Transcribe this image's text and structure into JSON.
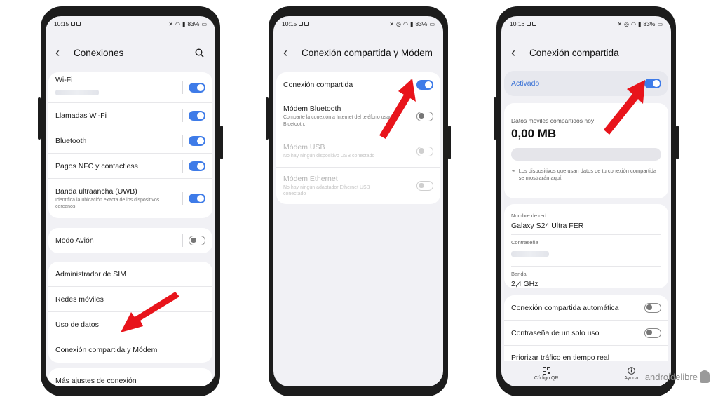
{
  "phone1": {
    "status": {
      "time": "10:15",
      "battery": "83%"
    },
    "header": {
      "title": "Conexiones"
    },
    "group1": [
      {
        "label": "Wi-Fi",
        "toggle": "on"
      },
      {
        "label": "Llamadas Wi-Fi",
        "toggle": "on"
      },
      {
        "label": "Bluetooth",
        "toggle": "on"
      },
      {
        "label": "Pagos NFC y contactless",
        "toggle": "on"
      },
      {
        "label": "Banda ultraancha (UWB)",
        "sub": "Identifica la ubicación exacta de los dispositivos cercanos.",
        "toggle": "on"
      }
    ],
    "group2": [
      {
        "label": "Modo Avión",
        "toggle": "off"
      }
    ],
    "group3": [
      {
        "label": "Administrador de SIM"
      },
      {
        "label": "Redes móviles"
      },
      {
        "label": "Uso de datos"
      },
      {
        "label": "Conexión compartida y Módem"
      }
    ],
    "group4": [
      {
        "label": "Más ajustes de conexión"
      }
    ]
  },
  "phone2": {
    "status": {
      "time": "10:15",
      "battery": "83%"
    },
    "header": {
      "title": "Conexión compartida y Módem"
    },
    "items": [
      {
        "label": "Conexión compartida",
        "toggle": "on"
      },
      {
        "label": "Módem Bluetooth",
        "sub": "Comparte la conexión a Internet del teléfono usando Bluetooth.",
        "toggle": "off"
      },
      {
        "label": "Módem USB",
        "sub": "No hay ningún dispositivo USB conectado",
        "toggle": "disabled"
      },
      {
        "label": "Módem Ethernet",
        "sub": "No hay ningún adaptador Ethernet USB conectado",
        "toggle": "disabled"
      }
    ]
  },
  "phone3": {
    "status": {
      "time": "10:16",
      "battery": "83%"
    },
    "header": {
      "title": "Conexión compartida"
    },
    "activated": {
      "label": "Activado",
      "toggle": "on"
    },
    "data": {
      "label": "Datos móviles compartidos hoy",
      "value": "0,00 MB",
      "info": "Los dispositivos que usan datos de tu conexión compartida se mostrarán aquí."
    },
    "network": {
      "name_label": "Nombre de red",
      "name_value": "Galaxy S24 Ultra FER",
      "password_label": "Contraseña",
      "band_label": "Banda",
      "band_value": "2,4 GHz"
    },
    "options": [
      {
        "label": "Conexión compartida automática",
        "toggle": "off"
      },
      {
        "label": "Contraseña de un solo uso",
        "toggle": "off"
      },
      {
        "label": "Priorizar tráfico en tiempo real"
      }
    ],
    "bottom_nav": [
      {
        "label": "Código QR",
        "icon": "qr-code-icon"
      },
      {
        "label": "Ayuda",
        "icon": "info-icon"
      }
    ]
  },
  "watermark": {
    "text": "androidelibre"
  },
  "colors": {
    "toggle_on": "#3e7be8",
    "accent_text": "#3b73d6",
    "arrow": "#e8141b"
  }
}
